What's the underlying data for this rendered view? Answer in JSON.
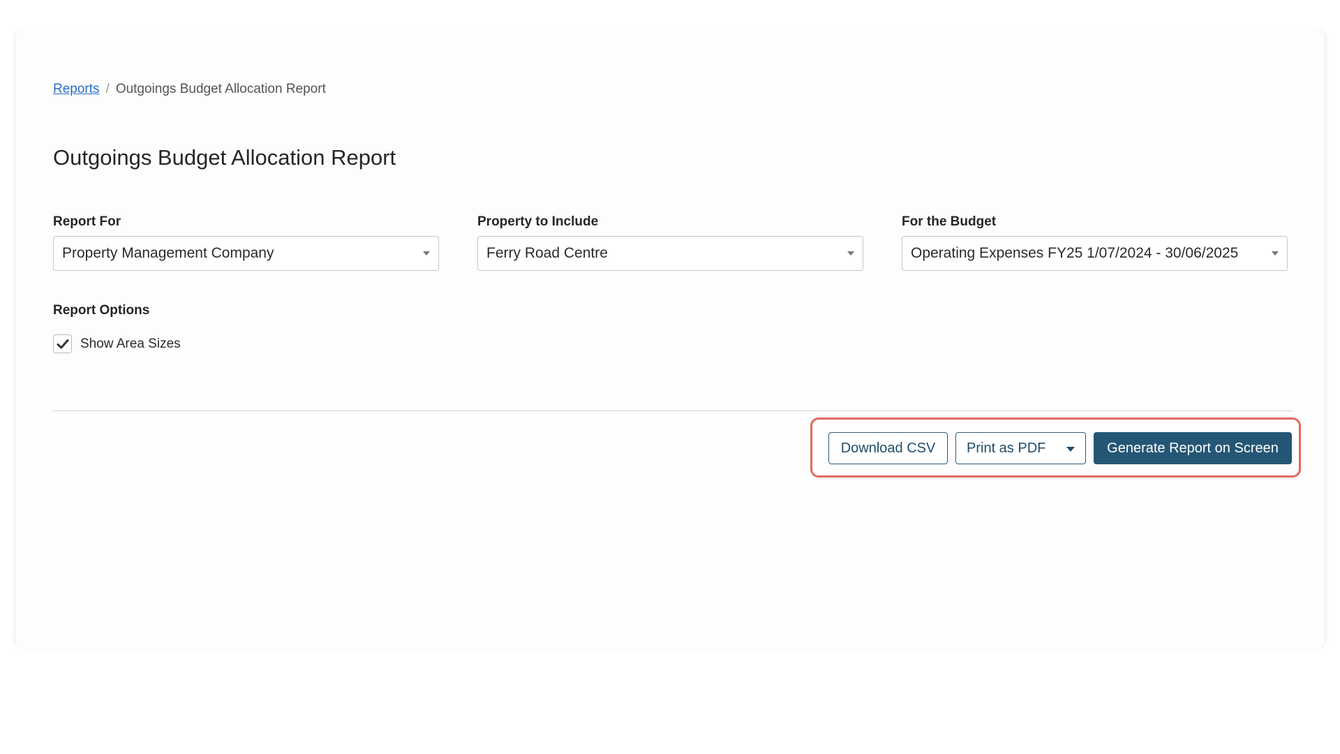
{
  "breadcrumb": {
    "root": "Reports",
    "separator": "/",
    "current": "Outgoings Budget Allocation Report"
  },
  "page": {
    "title": "Outgoings Budget Allocation Report"
  },
  "filters": {
    "report_for": {
      "label": "Report For",
      "value": "Property Management Company"
    },
    "property": {
      "label": "Property to Include",
      "value": "Ferry Road Centre"
    },
    "budget": {
      "label": "For the Budget",
      "value": "Operating Expenses FY25 1/07/2024 - 30/06/2025"
    }
  },
  "options": {
    "label": "Report Options",
    "show_area_sizes": {
      "label": "Show Area Sizes",
      "checked": true
    }
  },
  "actions": {
    "download_csv": "Download CSV",
    "print_pdf": "Print as PDF",
    "generate": "Generate Report on Screen"
  },
  "colors": {
    "primary": "#255675",
    "link": "#2a6fc2",
    "highlight": "#e06a5e"
  }
}
